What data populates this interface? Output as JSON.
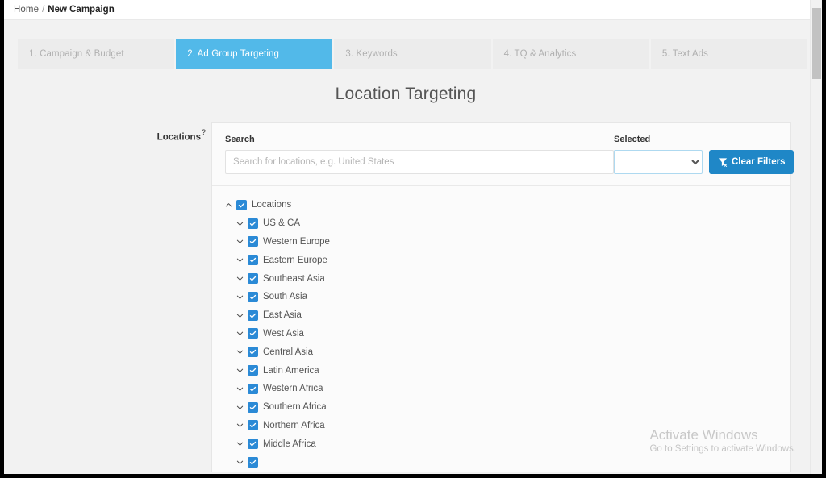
{
  "breadcrumb": {
    "home": "Home",
    "separator": "/",
    "current": "New Campaign"
  },
  "steps": [
    {
      "label": "1. Campaign & Budget",
      "active": false
    },
    {
      "label": "2. Ad Group Targeting",
      "active": true
    },
    {
      "label": "3. Keywords",
      "active": false
    },
    {
      "label": "4. TQ & Analytics",
      "active": false
    },
    {
      "label": "5. Text Ads",
      "active": false
    }
  ],
  "page": {
    "title": "Location Targeting"
  },
  "form": {
    "locations_label": "Locations",
    "locations_help": "?"
  },
  "search": {
    "label": "Search",
    "value": "",
    "placeholder": "Search for locations, e.g. United States"
  },
  "selected": {
    "label": "Selected",
    "value": "",
    "options": [
      ""
    ]
  },
  "clear_filters": {
    "label": "Clear Filters",
    "icon": "filter-remove-icon"
  },
  "tree": {
    "nodes": [
      {
        "label": "Locations",
        "level": 0,
        "checked": true,
        "expanded": true
      },
      {
        "label": "US & CA",
        "level": 1,
        "checked": true,
        "expanded": false
      },
      {
        "label": "Western Europe",
        "level": 1,
        "checked": true,
        "expanded": false
      },
      {
        "label": "Eastern Europe",
        "level": 1,
        "checked": true,
        "expanded": false
      },
      {
        "label": "Southeast Asia",
        "level": 1,
        "checked": true,
        "expanded": false
      },
      {
        "label": "South Asia",
        "level": 1,
        "checked": true,
        "expanded": false
      },
      {
        "label": "East Asia",
        "level": 1,
        "checked": true,
        "expanded": false
      },
      {
        "label": "West Asia",
        "level": 1,
        "checked": true,
        "expanded": false
      },
      {
        "label": "Central Asia",
        "level": 1,
        "checked": true,
        "expanded": false
      },
      {
        "label": "Latin America",
        "level": 1,
        "checked": true,
        "expanded": false
      },
      {
        "label": "Western Africa",
        "level": 1,
        "checked": true,
        "expanded": false
      },
      {
        "label": "Southern Africa",
        "level": 1,
        "checked": true,
        "expanded": false
      },
      {
        "label": "Northern Africa",
        "level": 1,
        "checked": true,
        "expanded": false
      },
      {
        "label": "Middle Africa",
        "level": 1,
        "checked": true,
        "expanded": false
      },
      {
        "label": "",
        "level": 1,
        "checked": true,
        "expanded": false
      }
    ]
  },
  "watermark": {
    "title": "Activate Windows",
    "subtitle": "Go to Settings to activate Windows."
  },
  "colors": {
    "accent_tab": "#52b9e9",
    "accent_button": "#1f87c7",
    "checkbox": "#2b8ad6",
    "page_bg": "#f2f2f2"
  }
}
